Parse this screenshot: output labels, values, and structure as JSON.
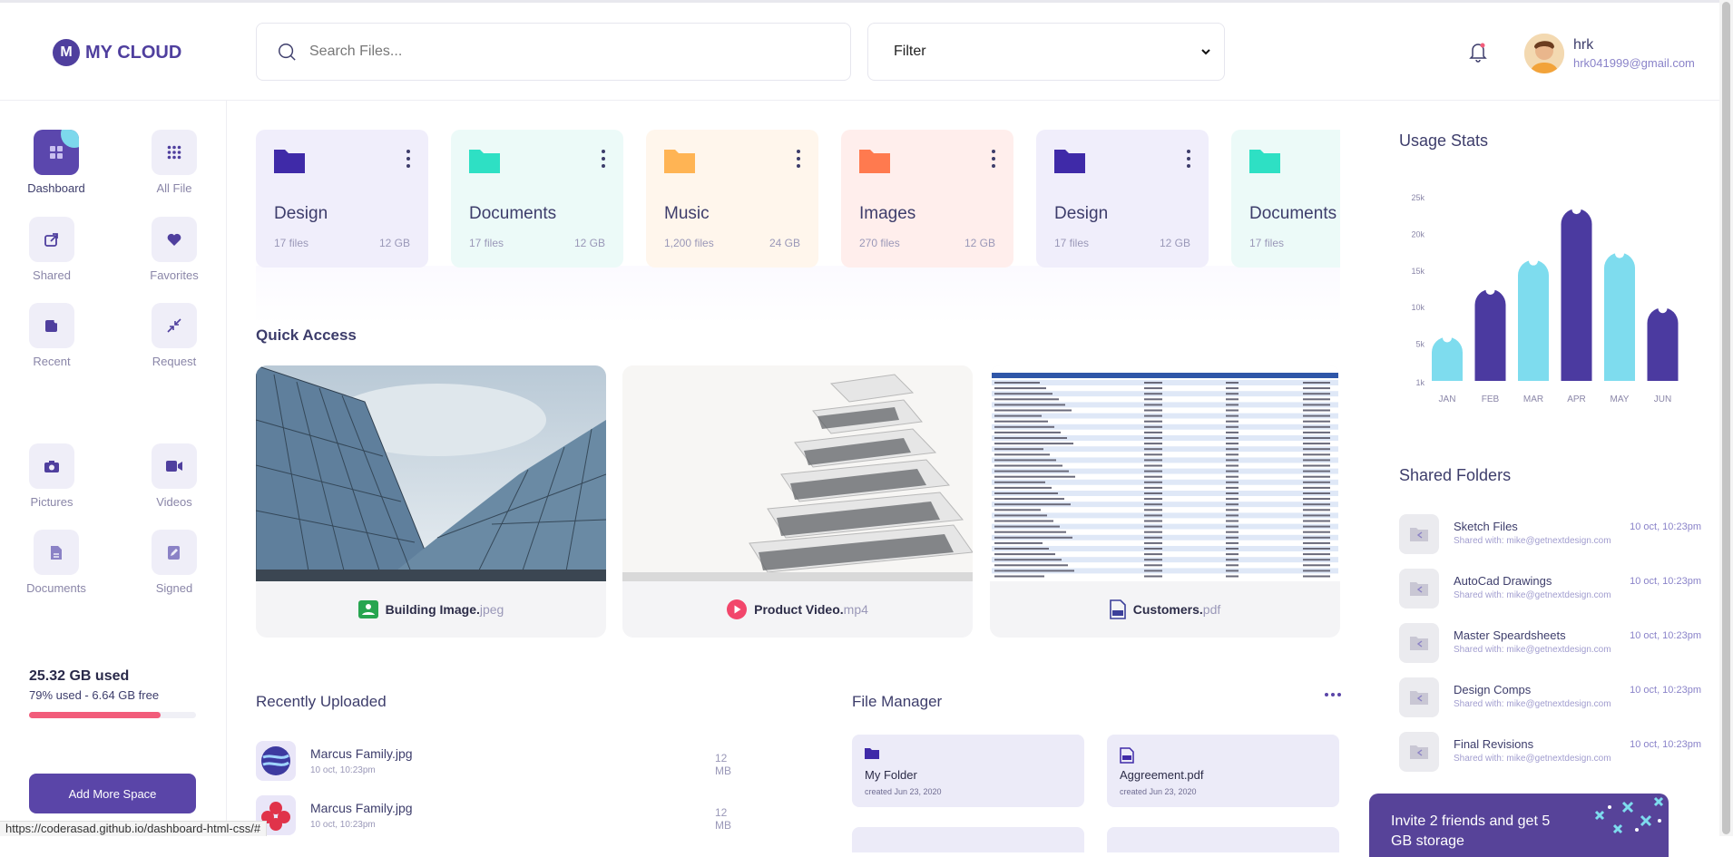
{
  "app": {
    "logo_letter": "M",
    "logo_text": "MY CLOUD"
  },
  "search": {
    "placeholder": "Search Files..."
  },
  "filter": {
    "value": "Filter"
  },
  "user": {
    "name": "hrk",
    "email": "hrk041999@gmail.com"
  },
  "sidebar": {
    "items": [
      {
        "label": "Dashboard",
        "icon": "grid-icon"
      },
      {
        "label": "All File",
        "icon": "apps-icon"
      },
      {
        "label": "Shared",
        "icon": "share-icon"
      },
      {
        "label": "Favorites",
        "icon": "heart-icon"
      },
      {
        "label": "Recent",
        "icon": "recent-icon"
      },
      {
        "label": "Request",
        "icon": "arrows-icon"
      },
      {
        "label": "Pictures",
        "icon": "camera-icon"
      },
      {
        "label": "Videos",
        "icon": "video-icon"
      },
      {
        "label": "Documents",
        "icon": "document-icon"
      },
      {
        "label": "Signed",
        "icon": "pen-icon"
      }
    ],
    "storage_used": "25.32 GB used",
    "storage_free": "79% used - 6.64 GB free",
    "storage_fraction": 0.79,
    "add_space": "Add More Space"
  },
  "folders": [
    {
      "name": "Design",
      "count": "17 files",
      "size": "12 GB",
      "color": "#3f2aa8",
      "bg": "#f0eefb"
    },
    {
      "name": "Documents",
      "count": "17 files",
      "size": "12 GB",
      "color": "#2ee0c4",
      "bg": "#ecfaf8"
    },
    {
      "name": "Music",
      "count": "1,200 files",
      "size": "24 GB",
      "color": "#ffb454",
      "bg": "#fff6ec"
    },
    {
      "name": "Images",
      "count": "270 files",
      "size": "12 GB",
      "color": "#ff7a4f",
      "bg": "#ffeeec"
    },
    {
      "name": "Design",
      "count": "17 files",
      "size": "12 GB",
      "color": "#3f2aa8",
      "bg": "#f0eefb"
    },
    {
      "name": "Documents",
      "count": "17 files",
      "size": "",
      "color": "#2ee0c4",
      "bg": "#ecfaf8"
    }
  ],
  "quick_access": {
    "title": "Quick Access",
    "items": [
      {
        "name": "Building Image.",
        "ext": "jpeg",
        "icon": "image-icon"
      },
      {
        "name": "Product Video.",
        "ext": "mp4",
        "icon": "play-icon"
      },
      {
        "name": "Customers.",
        "ext": "pdf",
        "icon": "pdf-icon"
      }
    ]
  },
  "recently_uploaded": {
    "title": "Recently Uploaded",
    "items": [
      {
        "name": "Marcus Family.jpg",
        "date": "10 oct, 10:23pm",
        "size": "12 MB"
      },
      {
        "name": "Marcus Family.jpg",
        "date": "10 oct, 10:23pm",
        "size": "12 MB"
      }
    ]
  },
  "file_manager": {
    "title": "File Manager",
    "items": [
      {
        "name": "My Folder",
        "date": "created Jun 23, 2020",
        "icon": "folder-icon"
      },
      {
        "name": "Aggreement.pdf",
        "date": "created Jun 23, 2020",
        "icon": "pdf-icon"
      }
    ]
  },
  "usage_stats": {
    "title": "Usage Stats"
  },
  "chart_data": {
    "type": "bar",
    "categories": [
      "JAN",
      "FEB",
      "MAR",
      "APR",
      "MAY",
      "JUN"
    ],
    "values": [
      6000,
      12500,
      16500,
      23500,
      17500,
      10000
    ],
    "yticks": [
      "25k",
      "20k",
      "15k",
      "10k",
      "5k",
      "1k"
    ],
    "ytick_values": [
      25000,
      20000,
      15000,
      10000,
      5000,
      1000
    ],
    "ylim": [
      0,
      25000
    ],
    "colors": [
      "#7edcee",
      "#4b3aa0",
      "#7edcee",
      "#4b3aa0",
      "#7edcee",
      "#4b3aa0"
    ],
    "title": "",
    "xlabel": "",
    "ylabel": ""
  },
  "shared_folders": {
    "title": "Shared Folders",
    "items": [
      {
        "name": "Sketch Files",
        "shared": "Shared with: mike@getnextdesign.com",
        "time": "10 oct, 10:23pm"
      },
      {
        "name": "AutoCad Drawings",
        "shared": "Shared with: mike@getnextdesign.com",
        "time": "10 oct, 10:23pm"
      },
      {
        "name": "Master Speardsheets",
        "shared": "Shared with: mike@getnextdesign.com",
        "time": "10 oct, 10:23pm"
      },
      {
        "name": "Design Comps",
        "shared": "Shared with: mike@getnextdesign.com",
        "time": "10 oct, 10:23pm"
      },
      {
        "name": "Final Revisions",
        "shared": "Shared with: mike@getnextdesign.com",
        "time": "10 oct, 10:23pm"
      }
    ]
  },
  "invite": {
    "text": "Invite 2 friends and get 5 GB storage"
  },
  "status_bar": {
    "url": "https://coderasad.github.io/dashboard-html-css/#"
  }
}
